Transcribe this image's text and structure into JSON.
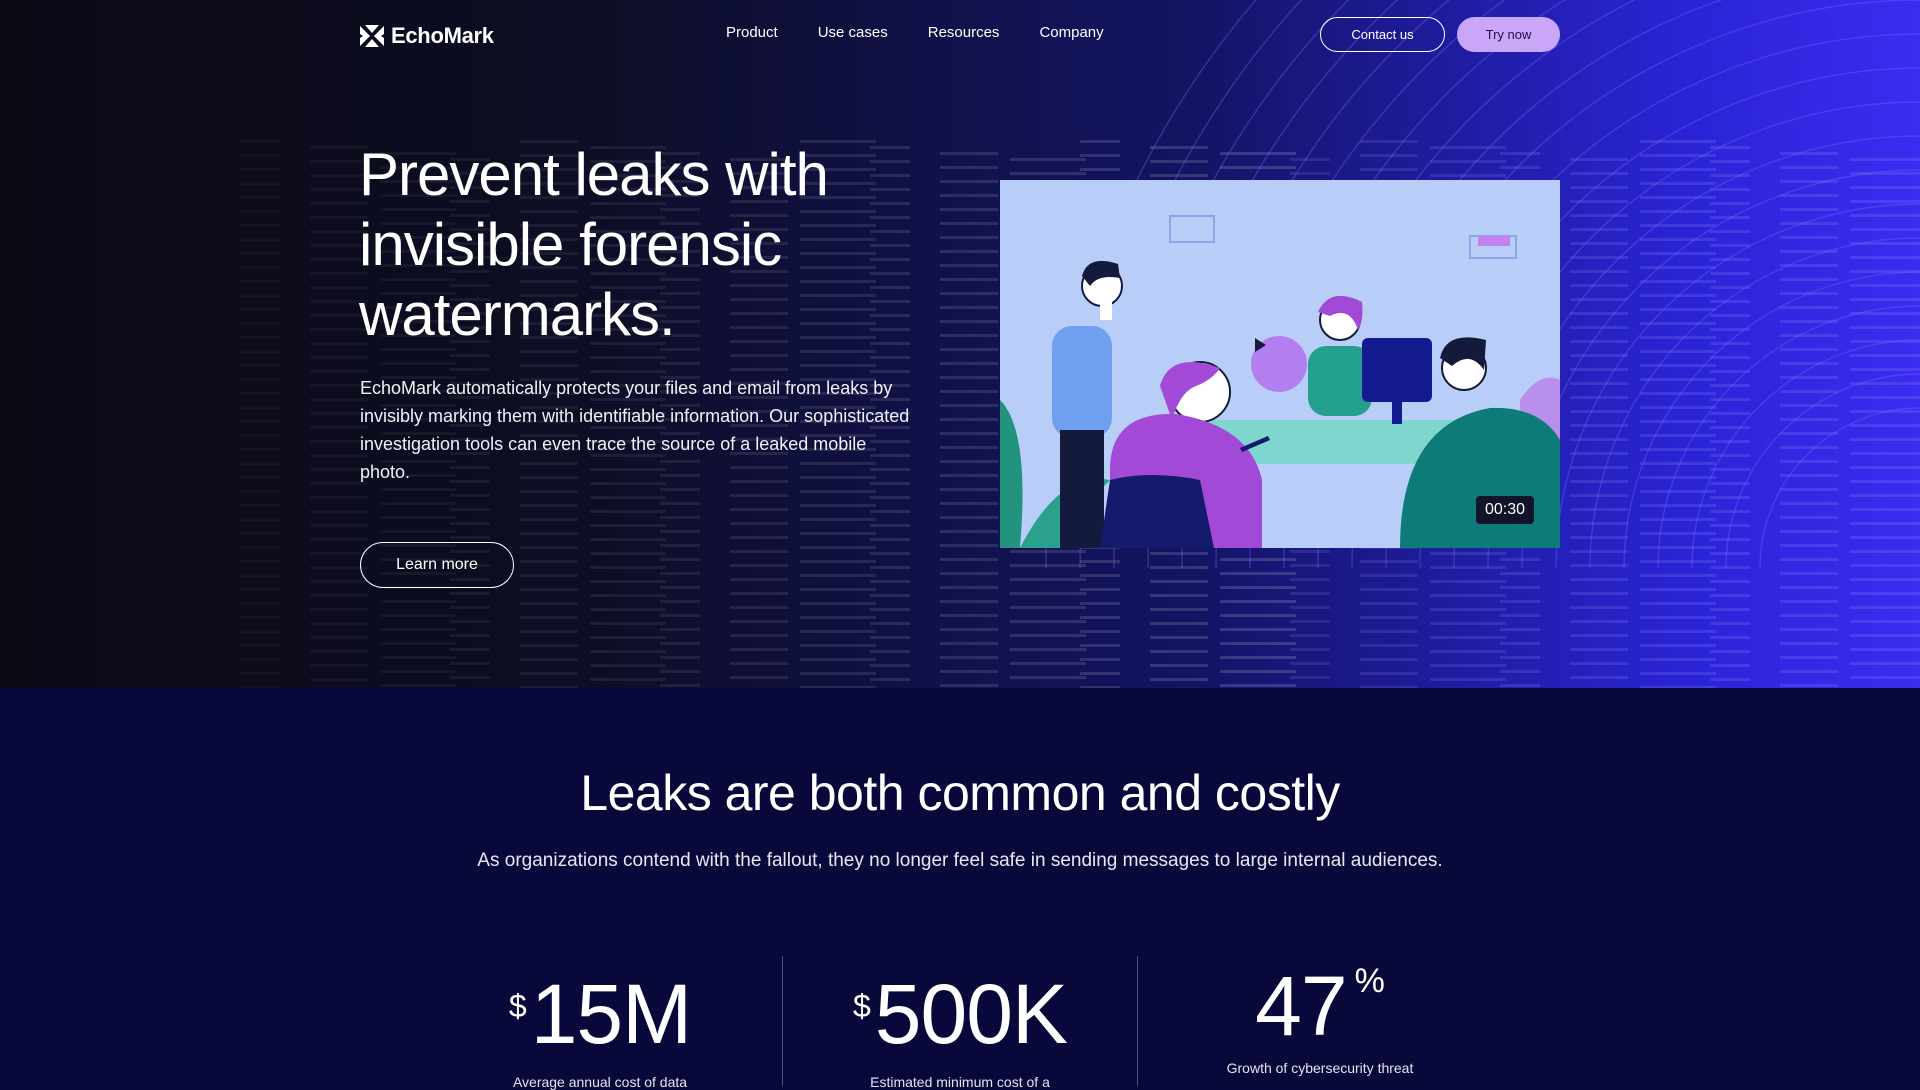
{
  "brand": {
    "name": "EchoMark",
    "logo_icon": "bowtie-x-icon"
  },
  "nav": {
    "links": [
      "Product",
      "Use cases",
      "Resources",
      "Company"
    ],
    "contact_label": "Contact us",
    "try_label": "Try now"
  },
  "hero": {
    "headline": "Prevent leaks with invisible forensic watermarks.",
    "description": "EchoMark automatically protects your files and email from leaks by invisibly marking them with identifiable information. Our sophisticated investigation tools can even trace the source of a leaked mobile photo.",
    "cta_label": "Learn more"
  },
  "video": {
    "duration": "00:30",
    "play_icon": "play-icon"
  },
  "stats_section": {
    "title": "Leaks are both common and costly",
    "subtitle": "As organizations contend with the fallout, they no longer feel safe in sending messages to large internal audiences.",
    "stats": [
      {
        "prefix": "$",
        "value": "15M",
        "suffix": "",
        "label": "Average annual cost of data"
      },
      {
        "prefix": "$",
        "value": "500K",
        "suffix": "",
        "label": "Estimated minimum cost of a"
      },
      {
        "prefix": "",
        "value": "47",
        "suffix": "%",
        "label": "Growth of cybersecurity threat"
      }
    ]
  },
  "colors": {
    "accent": "#c9a6f7",
    "background": "#08093a",
    "hero_blue": "#3b2df0"
  }
}
